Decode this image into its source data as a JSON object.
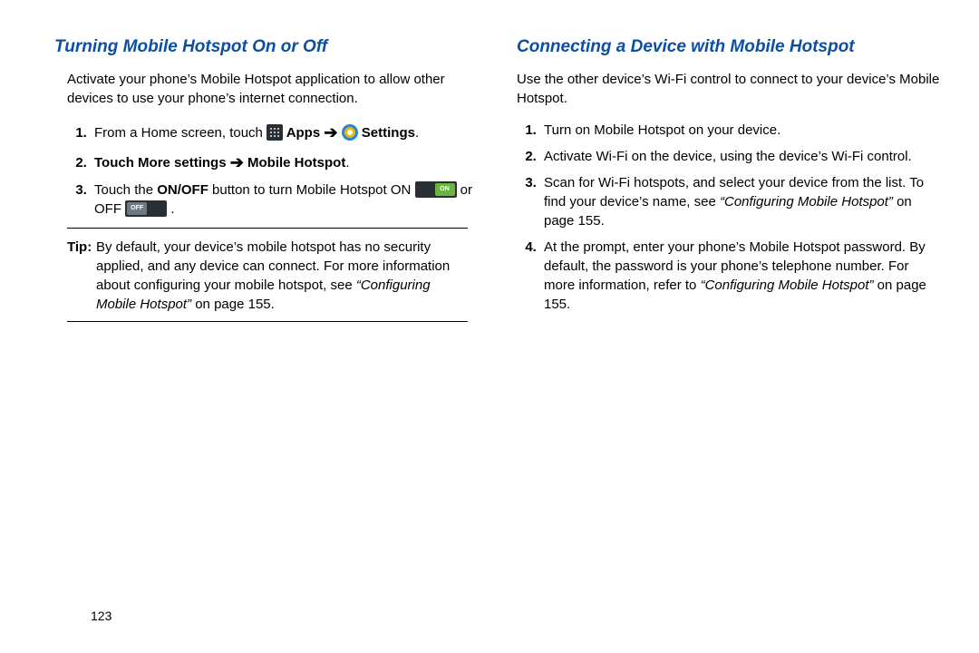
{
  "left": {
    "title": "Turning Mobile Hotspot On or Off",
    "intro": "Activate your phone’s Mobile Hotspot application to allow other devices to use your phone’s internet connection.",
    "step1_a": "From a Home screen, touch ",
    "step1_apps": " Apps ",
    "step1_settings": " Settings",
    "step2_a": "Touch ",
    "step2_b": "More settings ",
    "step2_c": " Mobile Hotspot",
    "step3_a": "Touch the ",
    "step3_onoff": "ON/OFF",
    "step3_b": " button to turn Mobile Hotspot ON ",
    "step3_c": " or OFF ",
    "toggle_on": "ON",
    "toggle_off": "OFF",
    "tip_label": "Tip: ",
    "tip_body_a": "By default, your device’s mobile hotspot has no security applied, and any device can connect. For more information about configuring your mobile hotspot, see ",
    "tip_ref": "“Configuring Mobile Hotspot”",
    "tip_body_b": " on page 155."
  },
  "right": {
    "title": "Connecting a Device with Mobile Hotspot",
    "intro": "Use the other device’s Wi-Fi control to connect to your device’s Mobile Hotspot.",
    "step1": "Turn on Mobile Hotspot on your device.",
    "step2": "Activate Wi-Fi on the device, using the device’s Wi-Fi control.",
    "step3_a": "Scan for Wi-Fi hotspots, and select your device from the list. To find your device’s name, see ",
    "step3_ref": "“Configuring Mobile Hotspot”",
    "step3_b": " on page 155.",
    "step4_a": "At the prompt, enter your phone’s Mobile Hotspot password. By default, the password is your phone’s telephone number. For more information, refer to ",
    "step4_ref": "“Configuring Mobile Hotspot”",
    "step4_b": " on page 155."
  },
  "page_number": "123"
}
